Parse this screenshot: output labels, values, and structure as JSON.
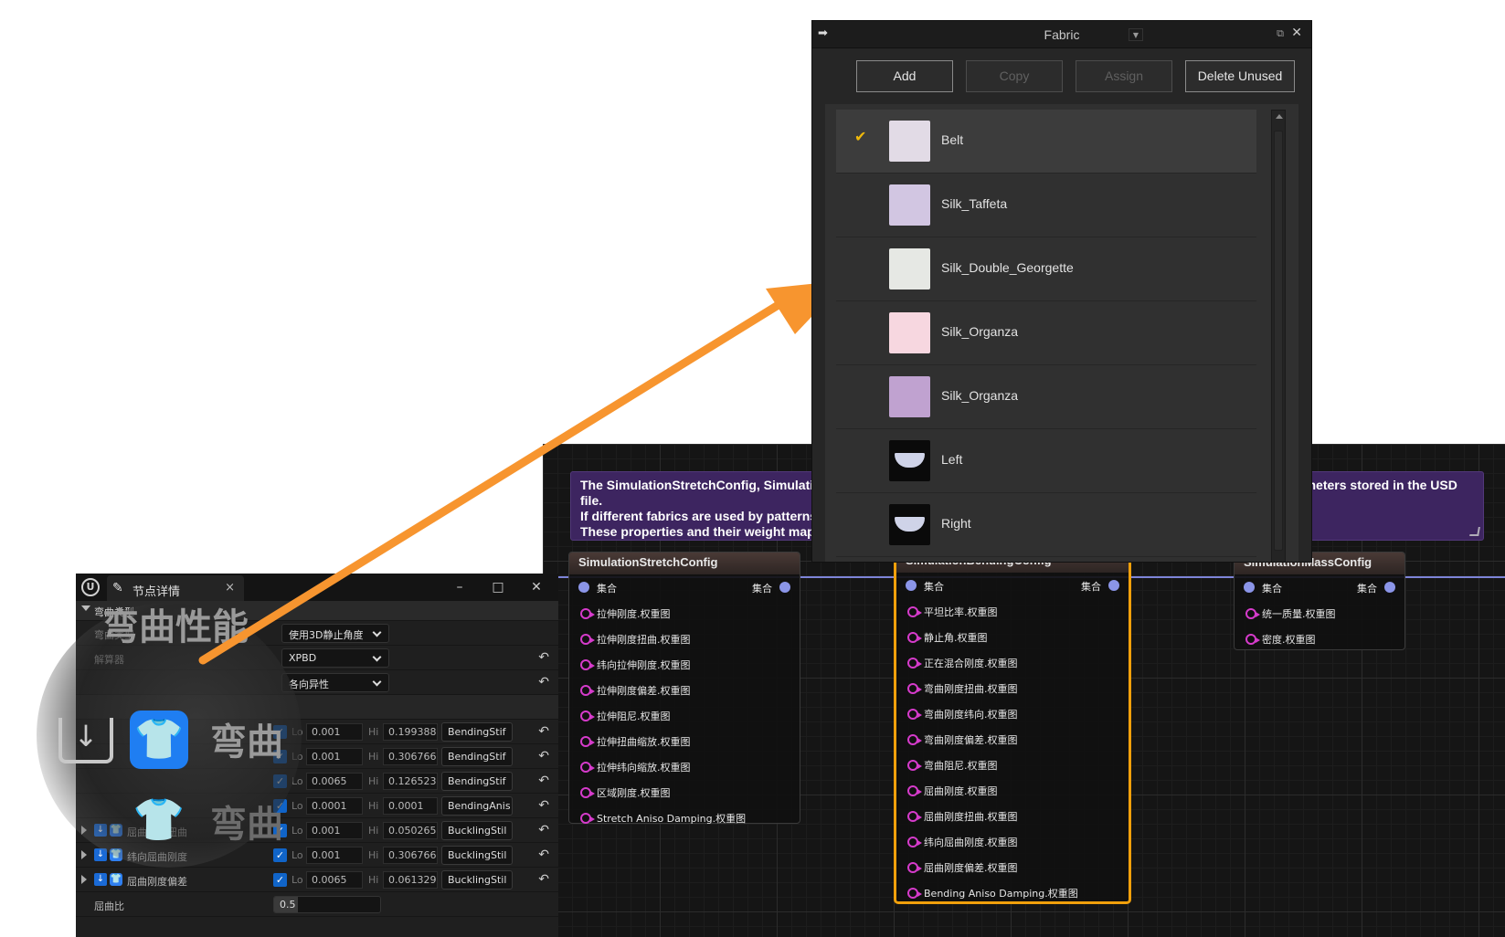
{
  "graph": {
    "comment": {
      "lines": [
        "The SimulationStretchConfig, SimulationBendingConfig and SimulationMassConfig nodes override the simulation parameters stored in the USD",
        "file.",
        "If different fabrics are used by patterns in the garment, the weight maps can be used to allow for the differences.",
        "These properties and their weight maps override the imported values."
      ]
    },
    "nodes": [
      {
        "title": "SimulationStretchConfig",
        "exec_in": "集合",
        "exec_out": "集合",
        "pins": [
          "拉伸刚度.权重图",
          "拉伸刚度扭曲.权重图",
          "纬向拉伸刚度.权重图",
          "拉伸刚度偏差.权重图",
          "拉伸阻尼.权重图",
          "拉伸扭曲缩放.权重图",
          "拉伸纬向缩放.权重图",
          "区域刚度.权重图",
          "Stretch Aniso Damping.权重图"
        ]
      },
      {
        "title": "SimulationBendingConfig",
        "exec_in": "集合",
        "exec_out": "集合",
        "pins": [
          "平坦比率.权重图",
          "静止角.权重图",
          "正在混合刚度.权重图",
          "弯曲刚度扭曲.权重图",
          "弯曲刚度纬向.权重图",
          "弯曲刚度偏差.权重图",
          "弯曲阻尼.权重图",
          "屈曲刚度.权重图",
          "屈曲刚度扭曲.权重图",
          "纬向屈曲刚度.权重图",
          "屈曲刚度偏差.权重图",
          "Bending Aniso Damping.权重图"
        ]
      },
      {
        "title": "SimulationMassConfig",
        "exec_in": "集合",
        "exec_out": "集合",
        "pins": [
          "统一质量.权重图",
          "密度.权重图"
        ]
      }
    ]
  },
  "details": {
    "tab_title": "节点详情",
    "category": "弯曲类型",
    "rows_dropdown": [
      {
        "label": "弯曲类型",
        "value": "使用3D静止角度"
      },
      {
        "label": "解算器",
        "value": "XPBD"
      },
      {
        "label": "",
        "value": "各向异性"
      }
    ],
    "weight_rows": [
      {
        "label": "",
        "lo": "0.001",
        "hi": "0.199388",
        "map": "BendingStif"
      },
      {
        "label": "",
        "lo": "0.001",
        "hi": "0.306766",
        "map": "BendingStif"
      },
      {
        "label": "",
        "lo": "0.0065",
        "hi": "0.126523",
        "map": "BendingStif"
      },
      {
        "label": "",
        "lo": "0.0001",
        "hi": "0.0001",
        "map": "BendingAnis"
      },
      {
        "label": "屈曲刚度扭曲",
        "lo": "0.001",
        "hi": "0.050265",
        "map": "BucklingStil"
      },
      {
        "label": "纬向屈曲刚度",
        "lo": "0.001",
        "hi": "0.306766",
        "map": "BucklingStil"
      },
      {
        "label": "屈曲刚度偏差",
        "lo": "0.0065",
        "hi": "0.061329",
        "map": "BucklingStil"
      }
    ],
    "lo_label": "Lo",
    "hi_label": "Hi",
    "ratio": {
      "label": "屈曲比",
      "value": "0.5",
      "fraction": 0.5
    },
    "magnifier": {
      "text_top": "弯曲性能",
      "text_mid": "弯曲",
      "text_bottom": "弯曲"
    }
  },
  "fabric": {
    "title": "Fabric",
    "buttons": [
      {
        "label": "Add",
        "enabled": true
      },
      {
        "label": "Copy",
        "enabled": false
      },
      {
        "label": "Assign",
        "enabled": false
      },
      {
        "label": "Delete Unused",
        "enabled": true
      }
    ],
    "items": [
      {
        "name": "Belt",
        "color": "#e2dbe6",
        "selected": true
      },
      {
        "name": "Silk_Taffeta",
        "color": "#d2c6e2",
        "selected": false
      },
      {
        "name": "Silk_Double_Georgette",
        "color": "#e6e8e4",
        "selected": false
      },
      {
        "name": "Silk_Organza",
        "color": "#f7d7e0",
        "selected": false
      },
      {
        "name": "Silk_Organza",
        "color": "#c0a2d0",
        "selected": false
      },
      {
        "name": "Left",
        "color": "image",
        "selected": false
      },
      {
        "name": "Right",
        "color": "image",
        "selected": false
      }
    ]
  },
  "colors": {
    "accent_arrow": "#f7952f",
    "selected_node": "#f1a00b",
    "comment_bg": "#3d2560",
    "check": "#f0b90b"
  }
}
